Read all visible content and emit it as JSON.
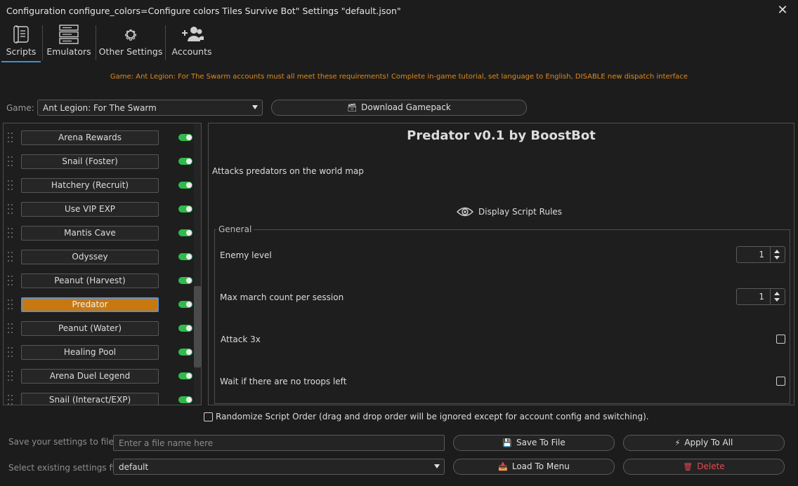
{
  "window": {
    "title": "Configuration configure_colors=Configure colors Tiles Survive Bot\" Settings \"default.json\"",
    "close_glyph": "✕"
  },
  "tabs": [
    {
      "label": "Scripts",
      "icon": "scroll-icon",
      "active": true
    },
    {
      "label": "Emulators",
      "icon": "server-icon",
      "active": false
    },
    {
      "label": "Other Settings",
      "icon": "gear-icon",
      "active": false
    },
    {
      "label": "Accounts",
      "icon": "users-add-icon",
      "active": false
    }
  ],
  "notice": "Game: Ant Legion: For The Swarm accounts must all meet these requirements! Complete in-game tutorial, set language to English, DISABLE new dispatch interface",
  "game": {
    "label": "Game:",
    "value": "Ant Legion: For The Swarm",
    "download_button": "Download Gamepack"
  },
  "scripts": [
    {
      "name": "Arena Rewards",
      "enabled": true,
      "selected": false
    },
    {
      "name": "Snail (Foster)",
      "enabled": true,
      "selected": false
    },
    {
      "name": "Hatchery (Recruit)",
      "enabled": true,
      "selected": false
    },
    {
      "name": "Use VIP EXP",
      "enabled": true,
      "selected": false
    },
    {
      "name": "Mantis Cave",
      "enabled": true,
      "selected": false
    },
    {
      "name": "Odyssey",
      "enabled": true,
      "selected": false
    },
    {
      "name": "Peanut (Harvest)",
      "enabled": true,
      "selected": false
    },
    {
      "name": "Predator",
      "enabled": true,
      "selected": true
    },
    {
      "name": "Peanut (Water)",
      "enabled": true,
      "selected": false
    },
    {
      "name": "Healing Pool",
      "enabled": true,
      "selected": false
    },
    {
      "name": "Arena Duel Legend",
      "enabled": true,
      "selected": false
    },
    {
      "name": "Snail (Interact/EXP)",
      "enabled": true,
      "selected": false
    }
  ],
  "detail": {
    "title": "Predator v0.1 by BoostBot",
    "description": "Attacks predators on the world map",
    "rules_label": "Display Script Rules",
    "group_label": "General",
    "options": {
      "enemy_level": {
        "label": "Enemy level",
        "value": "1"
      },
      "max_march": {
        "label": "Max march count per session",
        "value": "1"
      },
      "attack3x": {
        "label": "Attack 3x",
        "checked": false
      },
      "wait_troops": {
        "label": "Wait if there are no troops left",
        "checked": false
      }
    }
  },
  "randomize": {
    "label": "Randomize Script Order (drag and drop order will be ignored except for account config and switching).",
    "checked": false
  },
  "save": {
    "label": "Save your settings to file",
    "placeholder": "Enter a file name here",
    "save_button": "Save To File",
    "apply_button": "Apply To All"
  },
  "load": {
    "label": "Select existing settings file",
    "value": "default",
    "load_button": "Load To Menu",
    "delete_button": "Delete"
  },
  "colors": {
    "accent_orange": "#c8780e",
    "notice_orange": "#e08a1e",
    "toggle_green": "#2ebb4b",
    "tab_underline": "#3d8fd6",
    "delete_red": "#e5484d"
  }
}
